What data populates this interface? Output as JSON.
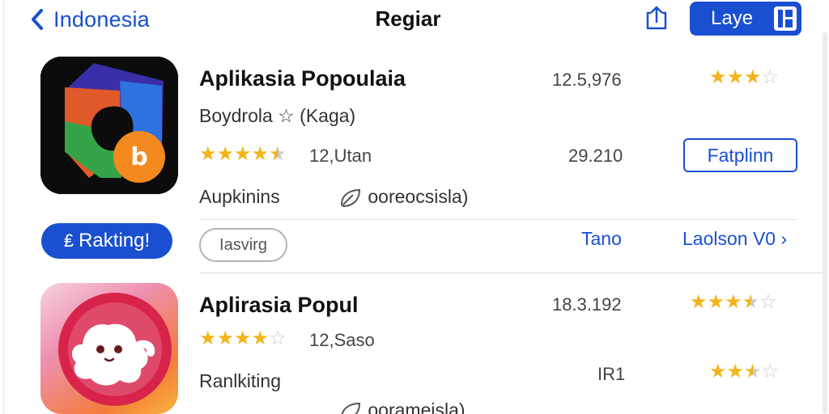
{
  "header": {
    "back_label": "Indonesia",
    "title": "Regiar",
    "layer_button": "Laye"
  },
  "app1": {
    "name": "Aplikasia Popoulaia",
    "developer": "Boydrola ☆ (Kaga)",
    "rating_count": "12,Utan",
    "stars": 4.5,
    "category": "Aupkinins",
    "tag": "ooreocsisla)",
    "right_number_1": "12.5,976",
    "right_stars_1": 3,
    "right_number_2": "29.210",
    "action_button": "Fatplinn"
  },
  "middle": {
    "ranking_button": "Rakting!",
    "ranking_prefix": "₤",
    "pill_label": "Iasvirg",
    "link_1": "Tano",
    "link_2": "Laolson V0 ›"
  },
  "app2": {
    "name": "Aplirasia Popul",
    "rating_count": "12,Saso",
    "stars": 4,
    "category": "Ranlkiting",
    "right_number_1": "18.3.192",
    "right_stars_1": 3.5,
    "right_value_2": "IR1",
    "right_stars_2": 2.5,
    "footer_partial": "oorameisla)"
  },
  "colors": {
    "accent": "#1a4fd1",
    "star": "#f3b41a",
    "star_empty": "#c9c9c9"
  }
}
